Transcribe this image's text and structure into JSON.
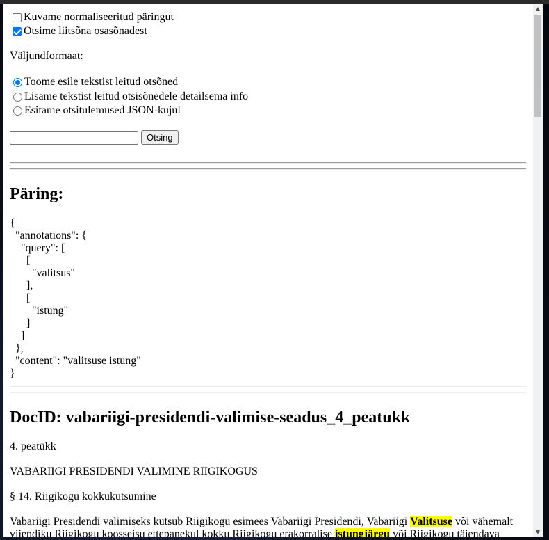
{
  "options": {
    "show_normalized": {
      "label": "Kuvame normaliseeritud päringut",
      "checked": false
    },
    "search_compounds": {
      "label": "Otsime liitsõna osasõnadest",
      "checked": true
    }
  },
  "output_format": {
    "label": "Väljundformaat:",
    "choices": [
      {
        "label": "Toome esile tekstist leitud otsõned",
        "checked": true
      },
      {
        "label": "Lisame tekstist leitud otsisõnedele detailsema info",
        "checked": false
      },
      {
        "label": "Esitame otsitulemused JSON-kujul",
        "checked": false
      }
    ]
  },
  "search": {
    "value": "",
    "button_label": "Otsing"
  },
  "query": {
    "heading": "Päring:",
    "json_lines": [
      "{",
      "  \"annotations\": {",
      "    \"query\": [",
      "      [",
      "        \"valitsus\"",
      "      ],",
      "      [",
      "        \"istung\"",
      "      ]",
      "    ]",
      "  },",
      "  \"content\": \"valitsuse istung\"",
      "}"
    ]
  },
  "result": {
    "heading": "DocID: vabariigi-presidendi-valimise-seadus_4_peatukk",
    "chapter": "4. peatükk",
    "chapter_title": "VABARIIGI PRESIDENDI VALIMINE RIIGIKOGUS",
    "section": "§ 14. Riigikogu kokkukutsumine",
    "body": {
      "line1_before": "Vabariigi Presidendi valimiseks kutsub Riigikogu esimees Vabariigi Presidendi, Vabariigi ",
      "hit1": "Valitsuse",
      "line1_after": " või vähemalt",
      "line2_before": "viiendiku Riigikogu koosseisu ettepanekul kokku Riigikogu erakorralise ",
      "hit2": "istungjärgu",
      "line2_after": " või Riigikogu täiendava"
    }
  }
}
